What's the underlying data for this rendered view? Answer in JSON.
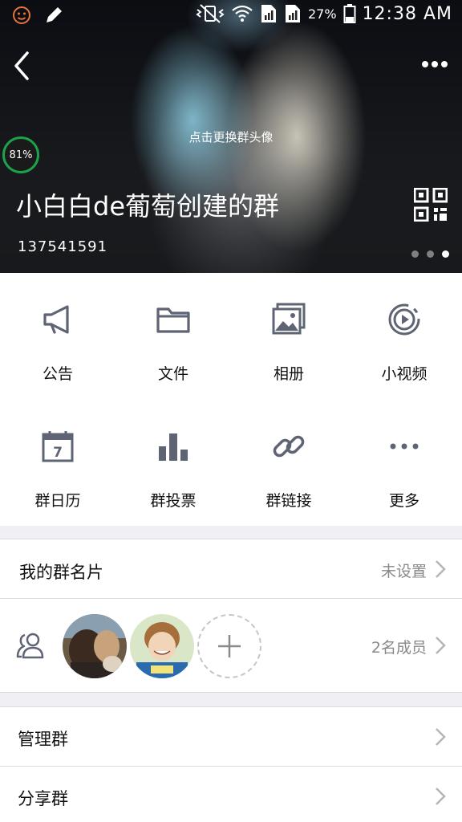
{
  "status_bar": {
    "battery_percent": "27%",
    "time": "12:38 AM"
  },
  "header": {
    "change_avatar_hint": "点击更换群头像",
    "floating_badge": "81%",
    "group_name": "小白白de葡萄创建的群",
    "group_id": "137541591",
    "page_indicator": {
      "count": 3,
      "active_index": 2
    }
  },
  "features": [
    {
      "label": "公告",
      "icon": "megaphone-icon"
    },
    {
      "label": "文件",
      "icon": "folder-icon"
    },
    {
      "label": "相册",
      "icon": "album-icon"
    },
    {
      "label": "小视频",
      "icon": "video-play-icon"
    },
    {
      "label": "群日历",
      "icon": "calendar-icon",
      "calendar_day": "7"
    },
    {
      "label": "群投票",
      "icon": "bar-chart-icon"
    },
    {
      "label": "群链接",
      "icon": "link-icon"
    },
    {
      "label": "更多",
      "icon": "more-dots-icon"
    }
  ],
  "group_card": {
    "title": "我的群名片",
    "value": "未设置"
  },
  "members": {
    "count_label": "2名成员"
  },
  "manage": {
    "title": "管理群"
  },
  "share": {
    "title": "分享群"
  },
  "colors": {
    "icon_gray": "#5e6473",
    "chevron": "#b5b5b5",
    "badge_ring": "#1aa34a",
    "background": "#efeff4"
  }
}
